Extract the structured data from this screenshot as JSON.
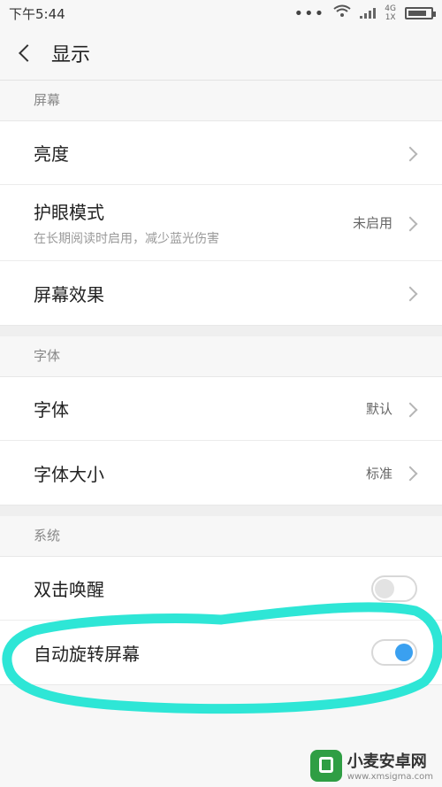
{
  "status_bar": {
    "time": "下午5:44",
    "dots": "•••",
    "net_top": "4G",
    "net_bottom": "1X"
  },
  "header": {
    "title": "显示"
  },
  "sections": [
    {
      "header": "屏幕",
      "items": [
        {
          "label": "亮度",
          "sub": "",
          "value": ""
        },
        {
          "label": "护眼模式",
          "sub": "在长期阅读时启用，减少蓝光伤害",
          "value": "未启用"
        },
        {
          "label": "屏幕效果",
          "sub": "",
          "value": ""
        }
      ]
    },
    {
      "header": "字体",
      "items": [
        {
          "label": "字体",
          "value": "默认"
        },
        {
          "label": "字体大小",
          "value": "标准"
        }
      ]
    },
    {
      "header": "系统",
      "items": [
        {
          "label": "双击唤醒",
          "toggle": "off"
        },
        {
          "label": "自动旋转屏幕",
          "toggle": "on"
        }
      ]
    }
  ],
  "annotation": {
    "color": "#2ee6d6"
  },
  "watermark": {
    "name": "小麦安卓网",
    "url": "www.xmsigma.com"
  }
}
